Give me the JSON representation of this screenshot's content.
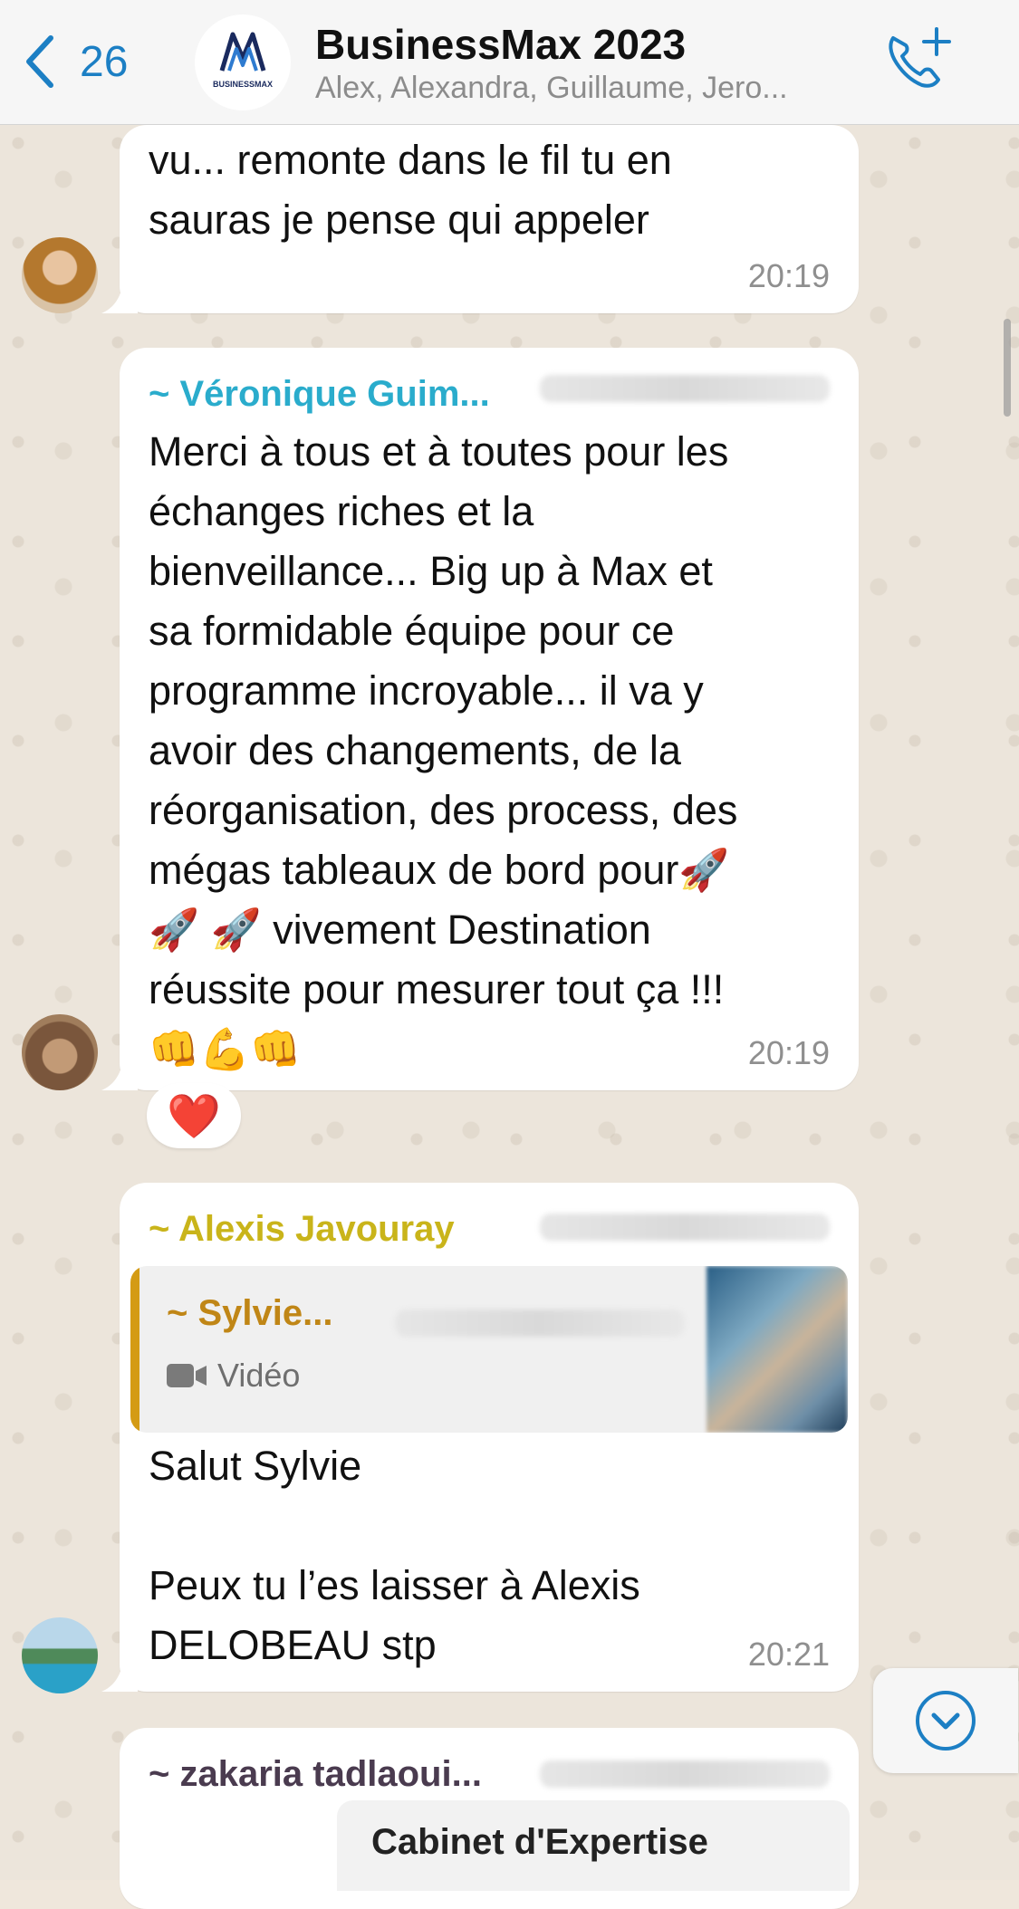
{
  "header": {
    "back_count": "26",
    "group_name": "BusinessMax 2023",
    "members": "Alex, Alexandra, Guillaume, Jero...",
    "logo_text": "BUSINESSMAX"
  },
  "messages": [
    {
      "text": "vu... remonte dans le fil tu en\nsauras je pense qui appeler",
      "time": "20:19"
    },
    {
      "sender": "~ Véronique Guim...",
      "sender_color": "#2aaccc",
      "text": "Merci à tous et à toutes pour les\néchanges riches et la\nbienveillance... Big up à Max et\nsa formidable équipe pour ce\nprogramme incroyable... il va y\navoir des changements, de la\nréorganisation, des process, des\nmégas tableaux de bord pour🚀\n🚀 🚀 vivement Destination\nréussite pour mesurer tout ça !!!\n👊💪👊",
      "time": "20:19",
      "reaction": "❤️"
    },
    {
      "sender": "~ Alexis Javouray",
      "sender_color": "#c9b41a",
      "quote": {
        "name": "~ Sylvie...",
        "type": "Vidéo"
      },
      "text": "Salut Sylvie\n\nPeux tu l’es laisser à Alexis\nDELOBEAU stp",
      "time": "20:21"
    },
    {
      "sender": "~ zakaria tadlaoui...",
      "sender_color": "#4a3b4f",
      "card_title": "Cabinet d'Expertise"
    }
  ],
  "icons": {
    "back": "chevron-left-icon",
    "call": "phone-add-icon",
    "scroll": "chevron-down-circle-icon",
    "video": "video-camera-icon"
  },
  "colors": {
    "accent": "#1c7fc4",
    "bubble": "#ffffff",
    "background": "#ece5db"
  }
}
